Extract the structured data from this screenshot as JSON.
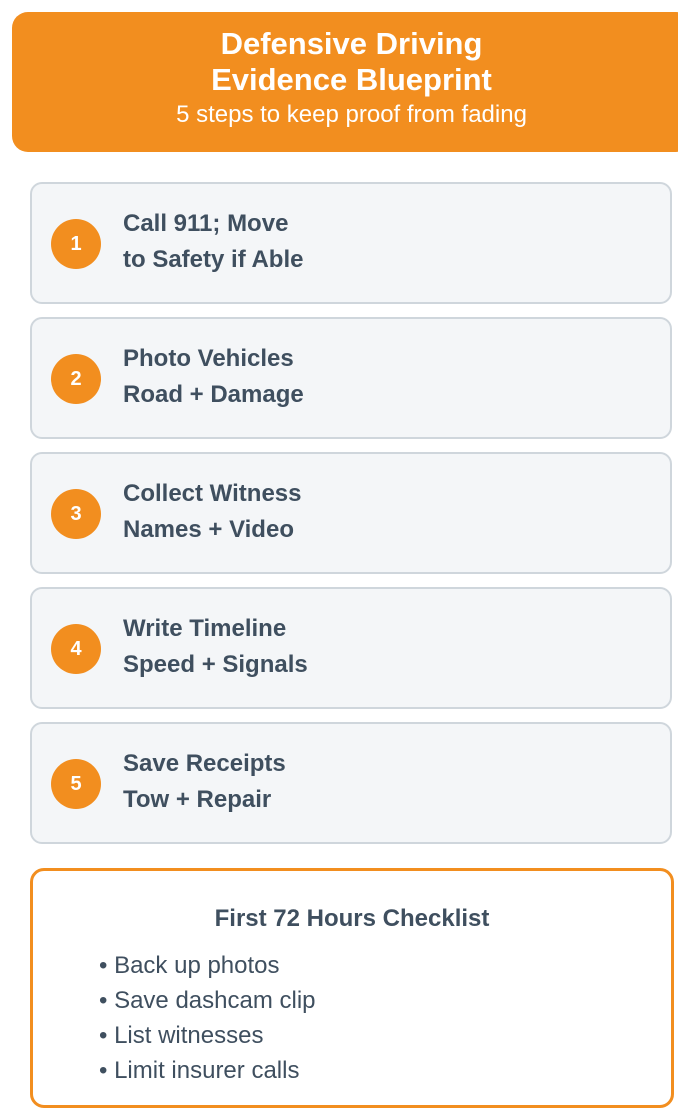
{
  "header": {
    "title_line1": "Defensive Driving",
    "title_line2": "Evidence Blueprint",
    "subtitle": "5 steps to keep proof from fading"
  },
  "steps": [
    {
      "number": "1",
      "line1": "Call 911; Move",
      "line2": "to Safety if Able"
    },
    {
      "number": "2",
      "line1": "Photo Vehicles",
      "line2": "Road + Damage"
    },
    {
      "number": "3",
      "line1": "Collect Witness",
      "line2": "Names + Video"
    },
    {
      "number": "4",
      "line1": "Write Timeline",
      "line2": "Speed + Signals"
    },
    {
      "number": "5",
      "line1": "Save Receipts",
      "line2": "Tow + Repair"
    }
  ],
  "checklist": {
    "title": "First 72 Hours Checklist",
    "items": [
      "• Back up photos",
      "• Save dashcam clip",
      "• List witnesses",
      "• Limit insurer calls"
    ]
  },
  "colors": {
    "accent": "#f28e1f",
    "text": "#3f4f5f",
    "card_bg": "#f4f6f8",
    "card_border": "#cfd6dc"
  }
}
